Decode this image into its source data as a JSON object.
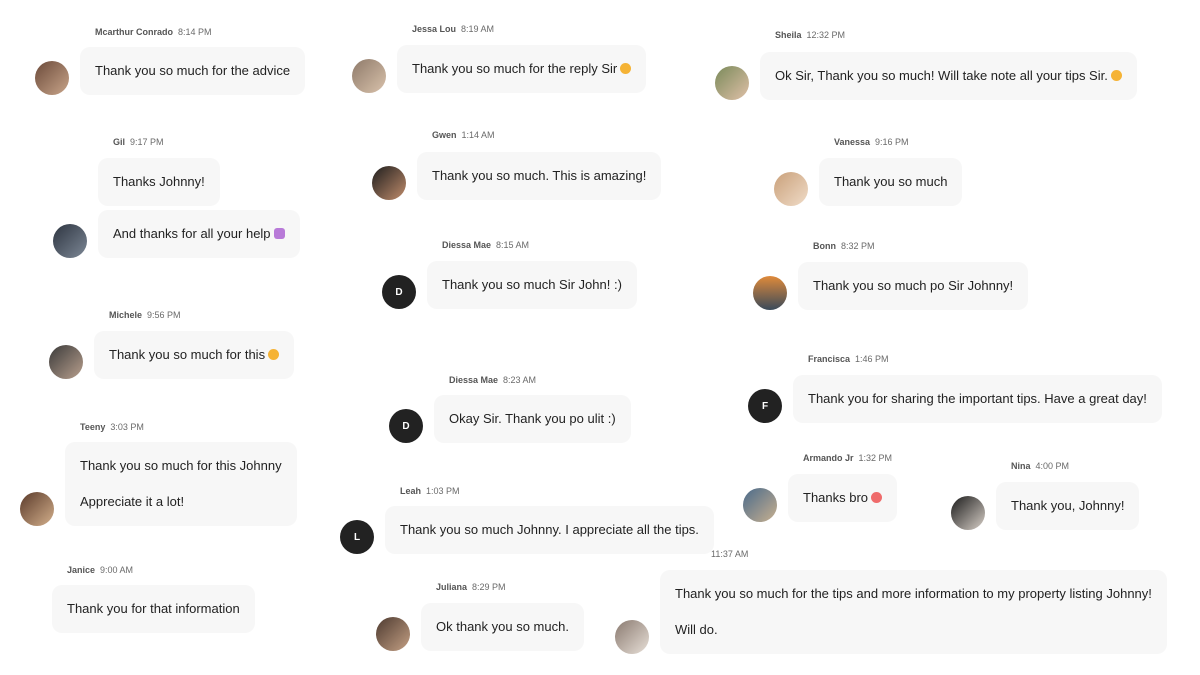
{
  "messages": [
    {
      "name": "Mcarthur Conrado",
      "time": "8:14 PM",
      "lines": [
        "Thank you so much for the advice"
      ],
      "avatar": {
        "type": "photo",
        "colors": [
          "#6b4a3a",
          "#c9a58a"
        ]
      }
    },
    {
      "name": "Gil",
      "time": "9:17 PM",
      "lines": [
        "Thanks Johnny!"
      ],
      "avatar": null
    },
    {
      "name": "",
      "time": "",
      "lines": [
        "And thanks for all your help"
      ],
      "emoji": "pray",
      "avatar": {
        "type": "photo",
        "colors": [
          "#2d3440",
          "#7d8896"
        ]
      }
    },
    {
      "name": "Michele",
      "time": "9:56 PM",
      "lines": [
        "Thank you so much for this"
      ],
      "emoji": "smile",
      "avatar": {
        "type": "photo",
        "colors": [
          "#3a3a3a",
          "#b9a08e"
        ]
      }
    },
    {
      "name": "Teeny",
      "time": "3:03 PM",
      "lines": [
        "Thank you so much for this Johnny",
        "Appreciate it a lot!"
      ],
      "avatar": {
        "type": "photo",
        "colors": [
          "#5a3a2a",
          "#d4b08c"
        ]
      }
    },
    {
      "name": "Janice",
      "time": "9:00 AM",
      "lines": [
        "Thank you for that information"
      ],
      "avatar": null
    },
    {
      "name": "Jessa Lou",
      "time": "8:19 AM",
      "lines": [
        "Thank you so much for the reply Sir"
      ],
      "emoji": "smile",
      "avatar": {
        "type": "photo",
        "colors": [
          "#8e7a6a",
          "#d9c2ab"
        ]
      }
    },
    {
      "name": "Gwen",
      "time": "1:14 AM",
      "lines": [
        "Thank you so much. This is amazing!"
      ],
      "avatar": {
        "type": "photo",
        "colors": [
          "#1d1d1d",
          "#c18d6c"
        ]
      }
    },
    {
      "name": "Diessa Mae",
      "time": "8:15 AM",
      "lines": [
        "Thank you so much Sir John! :)"
      ],
      "avatar": {
        "type": "letter",
        "letter": "D"
      }
    },
    {
      "name": "Diessa Mae",
      "time": "8:23 AM",
      "lines": [
        "Okay Sir. Thank you po ulit :)"
      ],
      "avatar": {
        "type": "letter",
        "letter": "D"
      }
    },
    {
      "name": "Leah",
      "time": "1:03 PM",
      "lines": [
        "Thank you so much Johnny. I appreciate all the tips."
      ],
      "avatar": {
        "type": "letter",
        "letter": "L"
      }
    },
    {
      "name": "Juliana",
      "time": "8:29 PM",
      "lines": [
        "Ok thank you so much."
      ],
      "avatar": {
        "type": "photo",
        "colors": [
          "#4d3a30",
          "#c4a084"
        ]
      }
    },
    {
      "name": "Sheila",
      "time": "12:32 PM",
      "lines": [
        "Ok Sir, Thank you so much! Will take note all your tips Sir."
      ],
      "emoji": "smile",
      "avatar": {
        "type": "photo",
        "colors": [
          "#7a8a5a",
          "#e0c0a8"
        ]
      }
    },
    {
      "name": "Vanessa",
      "time": "9:16 PM",
      "lines": [
        "Thank you so much"
      ],
      "avatar": {
        "type": "photo",
        "colors": [
          "#c9a07a",
          "#f0dcc8"
        ]
      }
    },
    {
      "name": "Bonn",
      "time": "8:32 PM",
      "lines": [
        "Thank you so much po Sir Johnny!"
      ],
      "avatar": {
        "type": "photo",
        "colors": [
          "#e08a3a",
          "#3a4a5a"
        ]
      }
    },
    {
      "name": "Francisca",
      "time": "1:46 PM",
      "lines": [
        "Thank you for sharing the important tips. Have a great day!"
      ],
      "avatar": {
        "type": "letter",
        "letter": "F"
      }
    },
    {
      "name": "Armando Jr",
      "time": "1:32 PM",
      "lines": [
        "Thanks bro"
      ],
      "emoji": "kiss",
      "avatar": {
        "type": "photo",
        "colors": [
          "#4a6a8a",
          "#c8b090"
        ]
      }
    },
    {
      "name": "Nina",
      "time": "4:00 PM",
      "lines": [
        "Thank you, Johnny!"
      ],
      "avatar": {
        "type": "photo",
        "colors": [
          "#1a1a1a",
          "#d8d0c8"
        ]
      }
    },
    {
      "name": "",
      "time": "11:37 AM",
      "lines": [
        "Thank you so much for the tips and more information to my property listing Johnny!",
        "Will do."
      ],
      "avatar": {
        "type": "photo",
        "colors": [
          "#8a7a70",
          "#e8e0d8"
        ]
      }
    }
  ]
}
